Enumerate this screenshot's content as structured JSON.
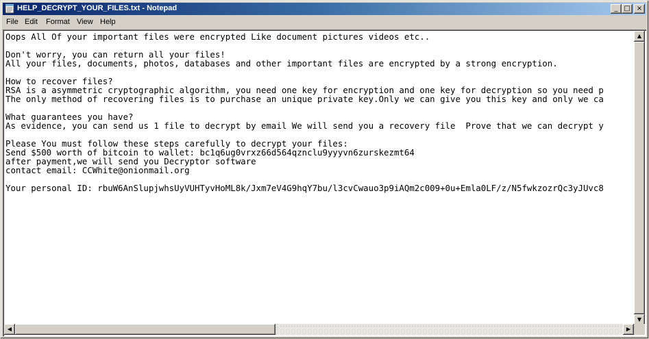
{
  "window": {
    "title": "HELP_DECRYPT_YOUR_FILES.txt - Notepad",
    "icon": "notepad-icon",
    "minimize_glyph": "_",
    "maximize_glyph": "□",
    "close_glyph": "×"
  },
  "menu": {
    "file": "File",
    "edit": "Edit",
    "format": "Format",
    "view": "View",
    "help": "Help"
  },
  "document": {
    "lines": [
      "Oops All Of your important files were encrypted Like document pictures videos etc..",
      "",
      "Don't worry, you can return all your files!",
      "All your files, documents, photos, databases and other important files are encrypted by a strong encryption.",
      "",
      "How to recover files?",
      "RSA is a asymmetric cryptographic algorithm, you need one key for encryption and one key for decryption so you need p",
      "The only method of recovering files is to purchase an unique private key.Only we can give you this key and only we ca",
      "",
      "What guarantees you have?",
      "As evidence, you can send us 1 file to decrypt by email We will send you a recovery file  Prove that we can decrypt y",
      "",
      "Please You must follow these steps carefully to decrypt your files:",
      "Send $500 worth of bitcoin to wallet: bc1q6ug0vrxz66d564qznclu9yyyvn6zurskezmt64",
      "after payment,we will send you Decryptor software",
      "contact email: CCWhite@onionmail.org",
      "",
      "Your personal ID: rbuW6AnSlupjwhsUyVUHTyvHoML8k/Jxm7eV4G9hqY7bu/l3cvCwauo3p9iAQm2c009+0u+Emla0LF/z/N5fwkzozrQc3yJUvc8"
    ]
  },
  "scrollbars": {
    "up_arrow": "▲",
    "down_arrow": "▼",
    "left_arrow": "◀",
    "right_arrow": "▶"
  },
  "colors": {
    "title_gradient_start": "#0a246a",
    "title_gradient_end": "#a6caf0",
    "chrome": "#d4d0c8",
    "editor_bg": "#ffffff"
  }
}
